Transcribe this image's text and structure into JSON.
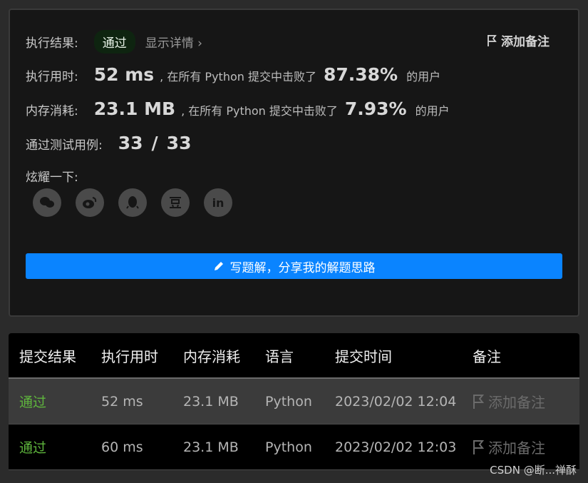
{
  "result": {
    "label": "执行结果:",
    "status": "通过",
    "details": "显示详情 ›",
    "add_note": "添加备注"
  },
  "runtime": {
    "label": "执行用时:",
    "value": "52 ms",
    "beat_prefix": ", 在所有 Python 提交中击败了",
    "percent": "87.38%",
    "suffix": "的用户"
  },
  "memory": {
    "label": "内存消耗:",
    "value": "23.1 MB",
    "beat_prefix": ", 在所有 Python 提交中击败了",
    "percent": "7.93%",
    "suffix": "的用户"
  },
  "tests": {
    "label": "通过测试用例:",
    "passed": "33",
    "sep": "/",
    "total": "33"
  },
  "share": {
    "label": "炫耀一下:",
    "items": [
      "wechat-icon",
      "weibo-icon",
      "qq-icon",
      "douban-icon",
      "linkedin-icon"
    ]
  },
  "write_solution": "写题解，分享我的解题思路",
  "table": {
    "headers": [
      "提交结果",
      "执行用时",
      "内存消耗",
      "语言",
      "提交时间",
      "备注"
    ],
    "rows": [
      {
        "status": "通过",
        "time": "52 ms",
        "memory": "23.1 MB",
        "lang": "Python",
        "submitted": "2023/02/02 12:04",
        "note": "添加备注"
      },
      {
        "status": "通过",
        "time": "60 ms",
        "memory": "23.1 MB",
        "lang": "Python",
        "submitted": "2023/02/02 12:03",
        "note": "添加备注"
      }
    ]
  },
  "watermark": "CSDN @断...禅酥",
  "colors": {
    "accent": "#0a84ff",
    "pass": "#5fb63d"
  }
}
